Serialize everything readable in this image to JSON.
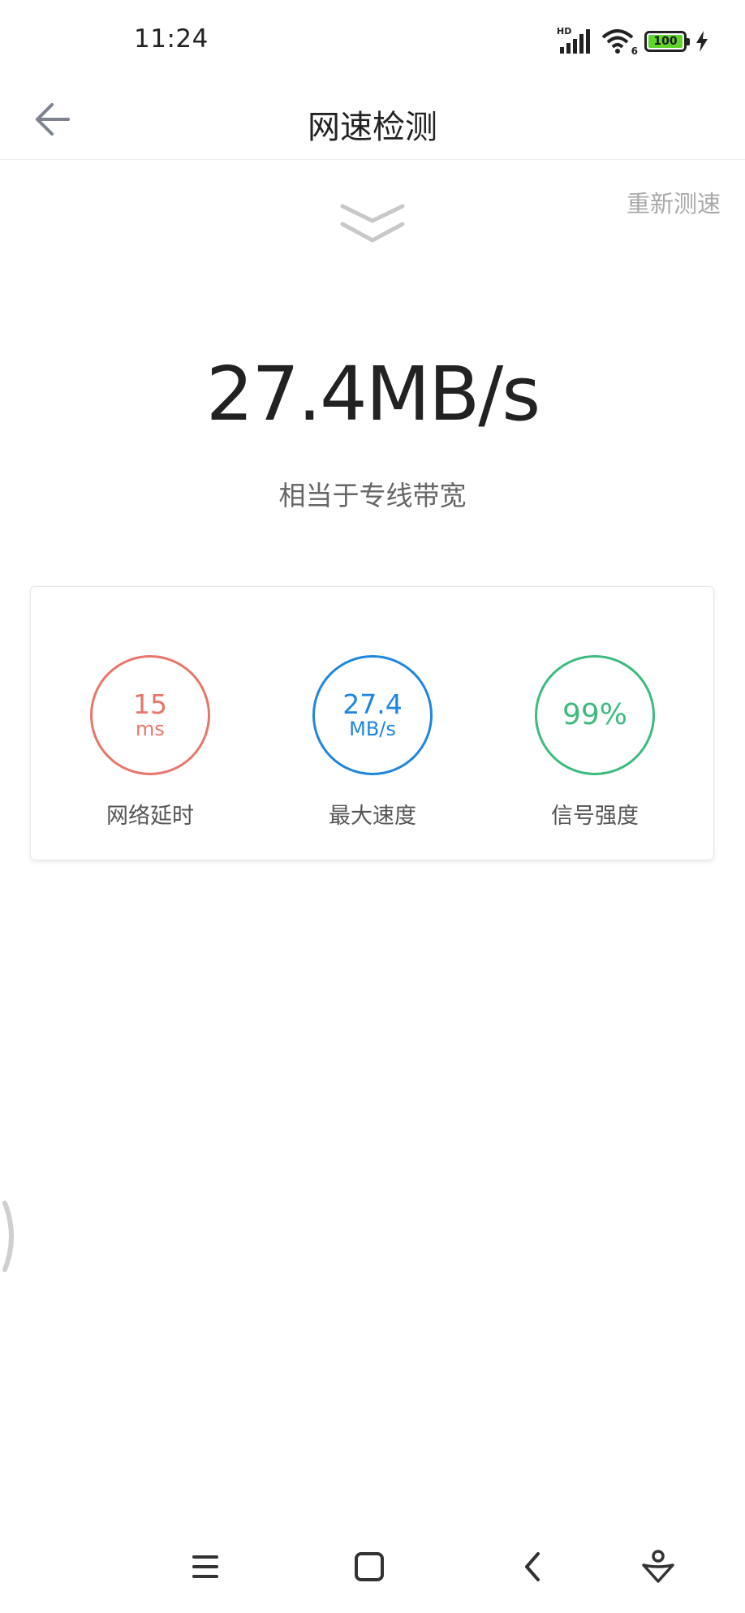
{
  "status_bar": {
    "time": "11:24",
    "network_badge": "HD",
    "wifi_badge": "6",
    "battery_level": "100",
    "battery_color": "#5fd42a"
  },
  "header": {
    "title": "网速检测",
    "back_icon": "arrow-left-icon"
  },
  "retest_label": "重新测速",
  "result": {
    "speed": "27.4MB/s",
    "description": "相当于专线带宽"
  },
  "stats": [
    {
      "value": "15",
      "unit": "ms",
      "label": "网络延时",
      "color": "#e8766a"
    },
    {
      "value": "27.4",
      "unit": "MB/s",
      "label": "最大速度",
      "color": "#1f86e0"
    },
    {
      "value": "99%",
      "unit": "",
      "label": "信号强度",
      "color": "#3dbb7f"
    }
  ],
  "nav_bar": {
    "items": [
      "menu-icon",
      "home-square-icon",
      "back-chevron-icon",
      "assistant-icon"
    ]
  }
}
